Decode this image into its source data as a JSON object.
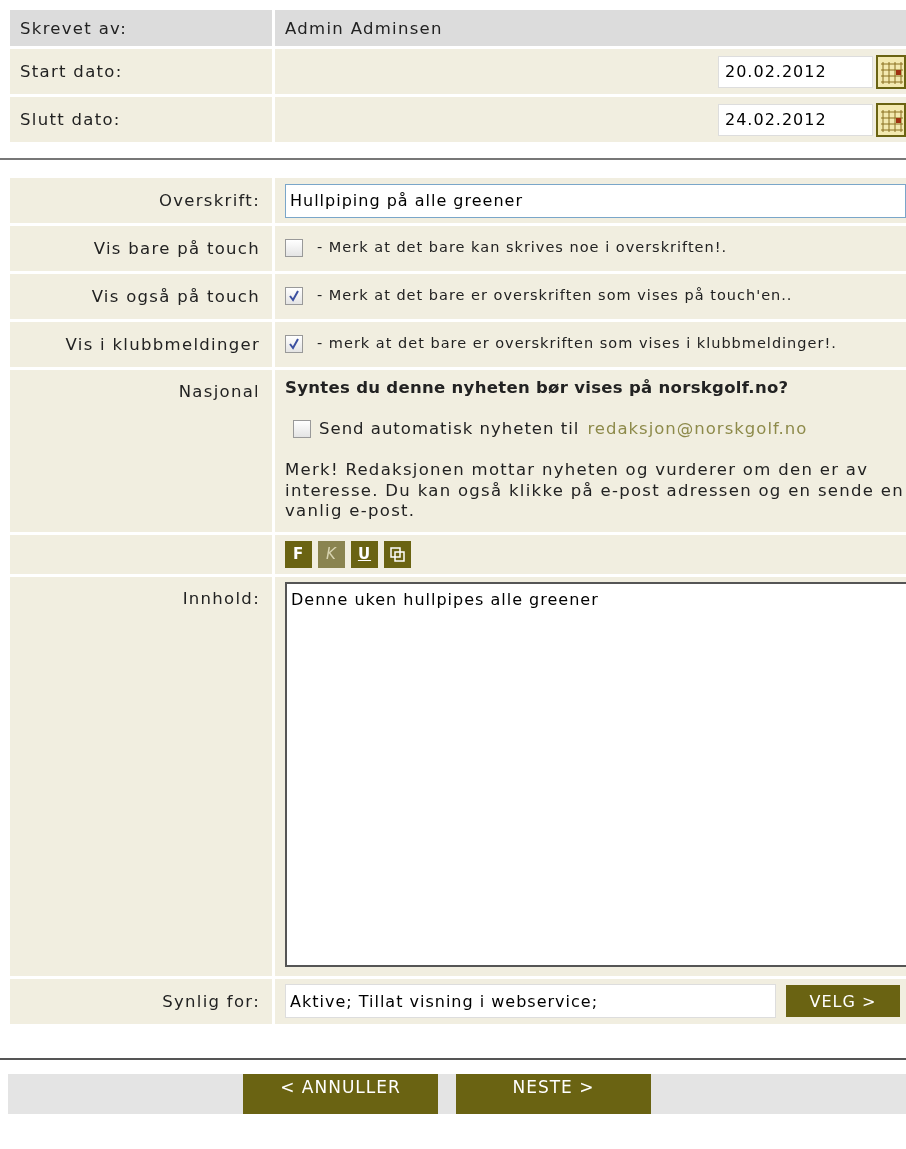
{
  "info_rows": [
    {
      "label": "Skrevet av:",
      "value": "Admin Adminsen",
      "kind": "text"
    },
    {
      "label": "Start dato:",
      "value": "20.02.2012",
      "kind": "date"
    },
    {
      "label": "Slutt dato:",
      "value": "24.02.2012",
      "kind": "date"
    }
  ],
  "title_field": {
    "label": "Overskrift:",
    "value": "Hullpiping på alle greener"
  },
  "options": [
    {
      "label": "Vis bare på touch",
      "checked": false,
      "note": "- Merk at det bare kan skrives noe i overskriften!."
    },
    {
      "label": "Vis også på touch",
      "checked": true,
      "note": "- Merk at det bare er overskriften som vises på touch'en.."
    },
    {
      "label": "Vis i klubbmeldinger",
      "checked": true,
      "note": "- merk at det bare er overskriften som vises i klubbmeldinger!."
    }
  ],
  "national": {
    "label": "Nasjonal",
    "question": "Syntes du denne nyheten bør vises på norskgolf.no?",
    "send_checked": false,
    "send_text": "Send automatisk nyheten til",
    "email": "redaksjon@norskgolf.no",
    "note": "Merk! Redaksjonen mottar nyheten og vurderer om den er av interesse.  Du kan også klikke på e-post adressen og en sende en vanlig e-post."
  },
  "format_buttons": [
    {
      "kind": "bold",
      "label": "F",
      "disabled": false
    },
    {
      "kind": "italic",
      "label": "K",
      "disabled": true
    },
    {
      "kind": "underline",
      "label": "U",
      "disabled": false
    },
    {
      "kind": "icon",
      "disabled": false
    }
  ],
  "content": {
    "label": "Innhold:",
    "value": "Denne uken hullpipes alle greener"
  },
  "visible_for": {
    "label": "Synlig for:",
    "value": "Aktive; Tillat visning i webservice;",
    "button": "VELG >"
  },
  "footer_buttons": [
    "< ANNULLER",
    "NESTE >"
  ]
}
